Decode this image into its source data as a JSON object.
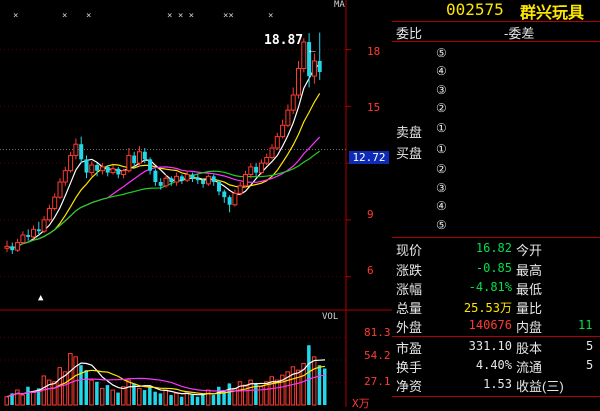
{
  "chart_data": [
    {
      "type": "candlestick",
      "price_ticks": [
        18,
        15,
        12,
        9,
        6
      ],
      "ylim": [
        4.5,
        20.2
      ],
      "highlight_price": "12.72",
      "max_price_label": "18.87",
      "ma_label": "MA",
      "candles": [
        {
          "o": 7.5,
          "c": 7.6,
          "h": 7.9,
          "l": 7.3
        },
        {
          "o": 7.6,
          "c": 7.4,
          "h": 7.8,
          "l": 7.2
        },
        {
          "o": 7.4,
          "c": 7.8,
          "h": 8.0,
          "l": 7.3
        },
        {
          "o": 7.8,
          "c": 8.2,
          "h": 8.4,
          "l": 7.7
        },
        {
          "o": 8.2,
          "c": 8.1,
          "h": 8.5,
          "l": 7.9
        },
        {
          "o": 8.1,
          "c": 8.5,
          "h": 8.7,
          "l": 8.0
        },
        {
          "o": 8.5,
          "c": 8.4,
          "h": 8.9,
          "l": 8.2
        },
        {
          "o": 8.4,
          "c": 9.0,
          "h": 9.2,
          "l": 8.3
        },
        {
          "o": 9.0,
          "c": 9.6,
          "h": 9.8,
          "l": 8.9
        },
        {
          "o": 9.6,
          "c": 10.2,
          "h": 10.4,
          "l": 9.5
        },
        {
          "o": 10.2,
          "c": 11.0,
          "h": 11.2,
          "l": 10.1
        },
        {
          "o": 11.0,
          "c": 11.6,
          "h": 11.8,
          "l": 10.8
        },
        {
          "o": 11.6,
          "c": 12.4,
          "h": 12.6,
          "l": 11.5
        },
        {
          "o": 12.4,
          "c": 13.0,
          "h": 13.3,
          "l": 12.2
        },
        {
          "o": 13.0,
          "c": 12.2,
          "h": 13.4,
          "l": 12.0
        },
        {
          "o": 12.2,
          "c": 11.5,
          "h": 12.4,
          "l": 11.2
        },
        {
          "o": 11.5,
          "c": 11.9,
          "h": 12.1,
          "l": 11.3
        },
        {
          "o": 11.9,
          "c": 11.6,
          "h": 12.0,
          "l": 11.3
        },
        {
          "o": 11.6,
          "c": 11.8,
          "h": 12.0,
          "l": 11.4
        },
        {
          "o": 11.8,
          "c": 11.5,
          "h": 11.9,
          "l": 11.3
        },
        {
          "o": 11.5,
          "c": 11.7,
          "h": 11.9,
          "l": 11.4
        },
        {
          "o": 11.7,
          "c": 11.4,
          "h": 11.8,
          "l": 11.2
        },
        {
          "o": 11.4,
          "c": 11.6,
          "h": 11.7,
          "l": 11.2
        },
        {
          "o": 11.6,
          "c": 12.4,
          "h": 12.8,
          "l": 11.5
        },
        {
          "o": 12.4,
          "c": 12.0,
          "h": 12.6,
          "l": 11.8
        },
        {
          "o": 12.0,
          "c": 12.6,
          "h": 12.9,
          "l": 11.8
        },
        {
          "o": 12.6,
          "c": 12.2,
          "h": 12.8,
          "l": 12.0
        },
        {
          "o": 12.2,
          "c": 11.6,
          "h": 12.3,
          "l": 11.4
        },
        {
          "o": 11.6,
          "c": 11.0,
          "h": 11.7,
          "l": 10.8
        },
        {
          "o": 11.0,
          "c": 10.8,
          "h": 11.2,
          "l": 10.6
        },
        {
          "o": 10.8,
          "c": 11.2,
          "h": 11.4,
          "l": 10.7
        },
        {
          "o": 11.2,
          "c": 11.0,
          "h": 11.3,
          "l": 10.8
        },
        {
          "o": 11.0,
          "c": 11.3,
          "h": 11.5,
          "l": 10.8
        },
        {
          "o": 11.3,
          "c": 11.1,
          "h": 11.4,
          "l": 10.9
        },
        {
          "o": 11.1,
          "c": 11.4,
          "h": 11.6,
          "l": 11.0
        },
        {
          "o": 11.4,
          "c": 11.2,
          "h": 11.5,
          "l": 11.0
        },
        {
          "o": 11.2,
          "c": 11.1,
          "h": 11.4,
          "l": 10.9
        },
        {
          "o": 11.1,
          "c": 10.9,
          "h": 11.2,
          "l": 10.7
        },
        {
          "o": 10.9,
          "c": 11.3,
          "h": 11.4,
          "l": 10.8
        },
        {
          "o": 11.3,
          "c": 11.0,
          "h": 11.4,
          "l": 10.8
        },
        {
          "o": 11.0,
          "c": 10.5,
          "h": 11.1,
          "l": 10.3
        },
        {
          "o": 10.5,
          "c": 10.2,
          "h": 10.6,
          "l": 9.9
        },
        {
          "o": 10.2,
          "c": 9.8,
          "h": 10.3,
          "l": 9.4
        },
        {
          "o": 9.8,
          "c": 10.4,
          "h": 10.6,
          "l": 9.7
        },
        {
          "o": 10.4,
          "c": 10.8,
          "h": 11.0,
          "l": 10.3
        },
        {
          "o": 10.8,
          "c": 11.4,
          "h": 11.6,
          "l": 10.7
        },
        {
          "o": 11.4,
          "c": 11.8,
          "h": 12.0,
          "l": 11.2
        },
        {
          "o": 11.8,
          "c": 11.5,
          "h": 12.0,
          "l": 11.3
        },
        {
          "o": 11.5,
          "c": 12.0,
          "h": 12.2,
          "l": 11.4
        },
        {
          "o": 12.0,
          "c": 12.3,
          "h": 12.5,
          "l": 11.9
        },
        {
          "o": 12.3,
          "c": 12.8,
          "h": 13.0,
          "l": 12.2
        },
        {
          "o": 12.8,
          "c": 13.4,
          "h": 13.6,
          "l": 12.7
        },
        {
          "o": 13.4,
          "c": 14.0,
          "h": 14.3,
          "l": 13.3
        },
        {
          "o": 14.0,
          "c": 14.8,
          "h": 15.1,
          "l": 13.9
        },
        {
          "o": 14.8,
          "c": 15.6,
          "h": 16.0,
          "l": 14.6
        },
        {
          "o": 15.6,
          "c": 17.0,
          "h": 17.4,
          "l": 15.4
        },
        {
          "o": 17.0,
          "c": 18.4,
          "h": 18.6,
          "l": 16.8
        },
        {
          "o": 18.4,
          "c": 16.6,
          "h": 18.87,
          "l": 16.0
        },
        {
          "o": 16.6,
          "c": 17.4,
          "h": 17.8,
          "l": 16.2
        },
        {
          "o": 17.4,
          "c": 16.82,
          "h": 18.9,
          "l": 16.4
        }
      ]
    },
    {
      "type": "bar",
      "label": "VOL",
      "ticks": [
        "81.3",
        "54.2",
        "27.1"
      ],
      "unit_label": "X万",
      "ylim": [
        0,
        100
      ],
      "values": [
        10,
        14,
        18,
        12,
        22,
        16,
        20,
        35,
        30,
        28,
        45,
        40,
        62,
        58,
        48,
        42,
        30,
        28,
        20,
        24,
        18,
        15,
        22,
        30,
        26,
        20,
        18,
        22,
        16,
        14,
        18,
        12,
        14,
        10,
        16,
        12,
        10,
        14,
        18,
        12,
        22,
        18,
        26,
        20,
        28,
        24,
        30,
        26,
        22,
        28,
        34,
        30,
        36,
        40,
        46,
        42,
        50,
        72,
        58,
        48,
        44
      ]
    }
  ],
  "right": {
    "code": "002575",
    "name": "群兴玩具",
    "weibi_label": "委比",
    "weicha_label": "-委差",
    "sell_label": "卖盘",
    "buy_label": "买盘",
    "levels": [
      "⑤",
      "④",
      "③",
      "②",
      "①",
      "①",
      "②",
      "③",
      "④",
      "⑤"
    ],
    "stats": [
      {
        "label": "现价",
        "value": "16.82",
        "label2": "今开",
        "value2": ""
      },
      {
        "label": "涨跌",
        "value": "-0.85",
        "label2": "最高",
        "value2": ""
      },
      {
        "label": "涨幅",
        "value": "-4.81%",
        "label2": "最低",
        "value2": ""
      },
      {
        "label": "总量",
        "value": "25.53万",
        "label2": "量比",
        "value2": ""
      },
      {
        "label": "外盘",
        "value": "140676",
        "label2": "内盘",
        "value2": "11"
      }
    ],
    "stats2": [
      {
        "label": "市盈",
        "value": "331.10",
        "label2": "股本",
        "value2": "5"
      },
      {
        "label": "换手",
        "value": "4.40%",
        "label2": "流通",
        "value2": "5"
      },
      {
        "label": "净资",
        "value": "1.53",
        "label2": "收益(三)",
        "value2": ""
      }
    ]
  }
}
